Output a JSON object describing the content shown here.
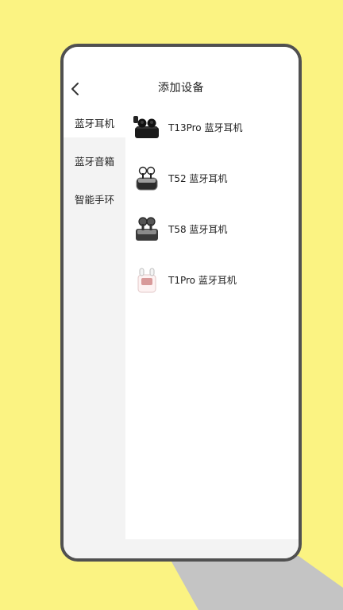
{
  "header": {
    "title": "添加设备",
    "back_icon": "chevron-left-icon"
  },
  "sidebar": {
    "items": [
      {
        "label": "蓝牙耳机",
        "active": true
      },
      {
        "label": "蓝牙音箱",
        "active": false
      },
      {
        "label": "智能手环",
        "active": false
      }
    ]
  },
  "devices": [
    {
      "label": "T13Pro 蓝牙耳机",
      "icon": "black-earbuds-case-icon"
    },
    {
      "label": "T52 蓝牙耳机",
      "icon": "transparent-earbuds-case-icon"
    },
    {
      "label": "T58 蓝牙耳机",
      "icon": "dark-earbuds-case-icon"
    },
    {
      "label": "T1Pro 蓝牙耳机",
      "icon": "pink-earbuds-case-icon"
    }
  ],
  "colors": {
    "background": "#fbf382",
    "frame": "#505050",
    "sidebar": "#f3f3f3"
  }
}
